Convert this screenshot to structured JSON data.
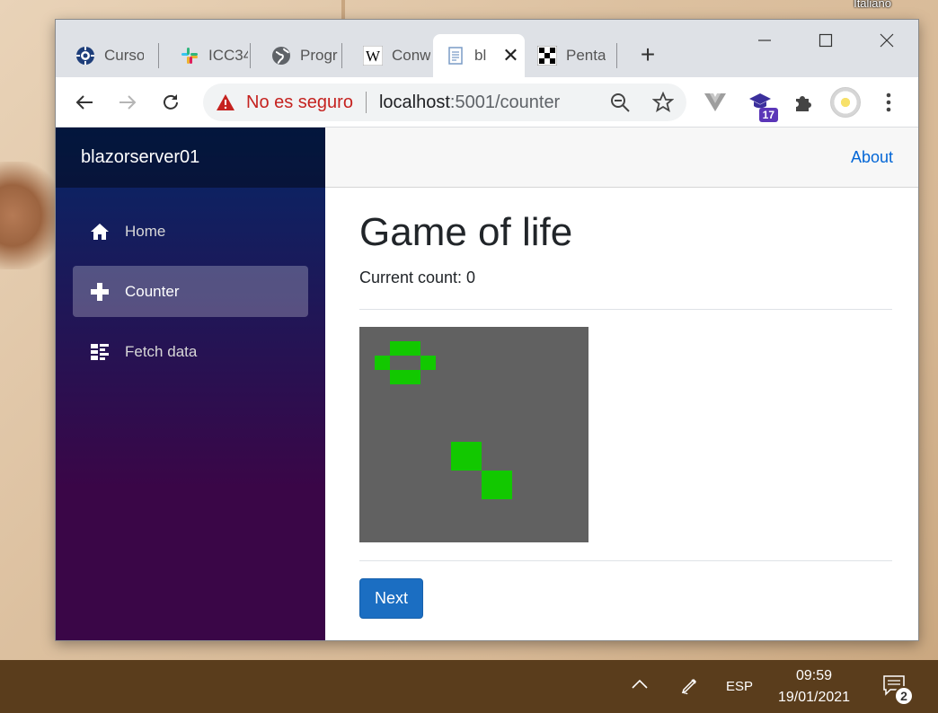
{
  "desktop": {
    "language_label": "Italiano"
  },
  "browser": {
    "tabs": [
      {
        "label": "Curso",
        "icon": "gear-globe-icon"
      },
      {
        "label": "ICC34",
        "icon": "slack-icon"
      },
      {
        "label": "Progr",
        "icon": "globe-icon"
      },
      {
        "label": "Conw",
        "icon": "wikipedia-icon"
      },
      {
        "label": "bl",
        "icon": "document-icon",
        "active": true
      },
      {
        "label": "Penta",
        "icon": "pattern-icon"
      }
    ],
    "address": {
      "security_label": "No es seguro",
      "host": "localhost",
      "rest": ":5001/counter"
    },
    "extension_badge": "17"
  },
  "app": {
    "brand": "blazorserver01",
    "nav": [
      {
        "label": "Home",
        "icon": "home-icon"
      },
      {
        "label": "Counter",
        "icon": "plus-icon",
        "active": true
      },
      {
        "label": "Fetch data",
        "icon": "list-icon"
      }
    ],
    "top_link": "About",
    "title": "Game of life",
    "count_text": "Current count: 0",
    "next_label": "Next",
    "colors": {
      "cell_alive": "#12c800",
      "board_bg": "#616161",
      "button": "#1b6ec2"
    }
  },
  "taskbar": {
    "language": "ESP",
    "time": "09:59",
    "date": "19/01/2021",
    "notification_count": "2"
  }
}
